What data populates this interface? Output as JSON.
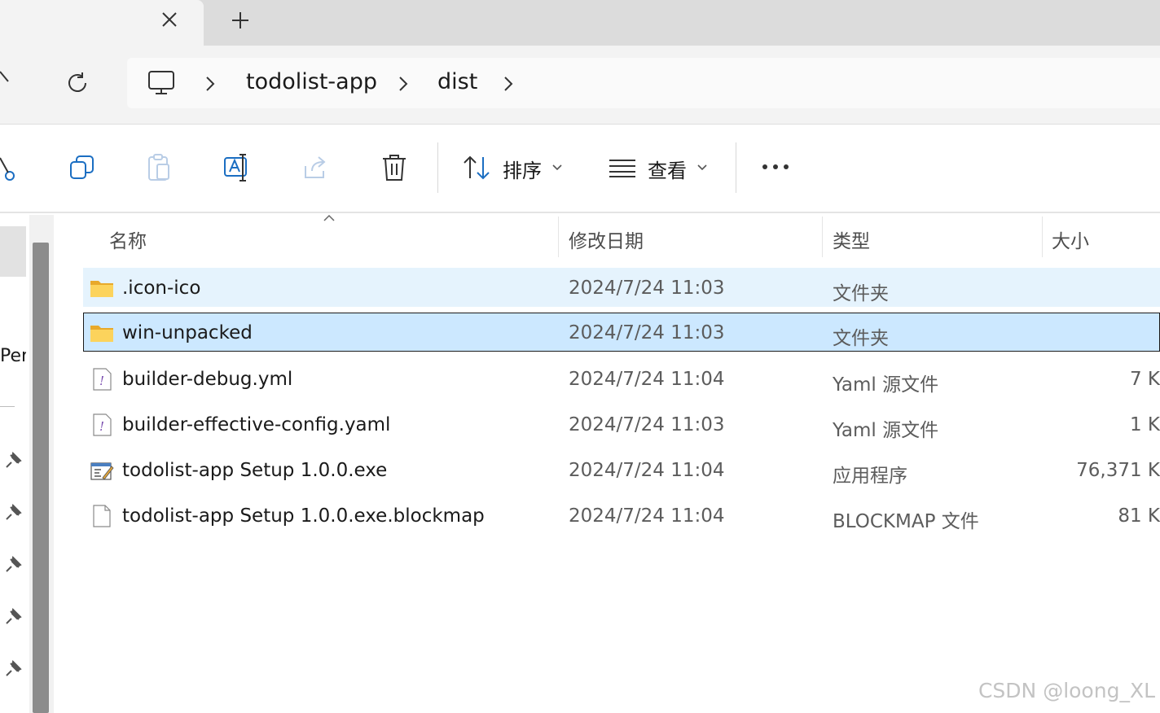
{
  "breadcrumb": {
    "items": [
      "todolist-app",
      "dist"
    ]
  },
  "toolbar": {
    "sort_label": "排序",
    "view_label": "查看"
  },
  "sidebar": {
    "partial_text": "Pers"
  },
  "file_list": {
    "columns": {
      "name": "名称",
      "date": "修改日期",
      "type": "类型",
      "size": "大小"
    },
    "rows": [
      {
        "name": ".icon-ico",
        "date": "2024/7/24 11:03",
        "type": "文件夹",
        "size": "",
        "icon": "folder-icon"
      },
      {
        "name": "win-unpacked",
        "date": "2024/7/24 11:03",
        "type": "文件夹",
        "size": "",
        "icon": "folder-icon"
      },
      {
        "name": "builder-debug.yml",
        "date": "2024/7/24 11:04",
        "type": "Yaml 源文件",
        "size": "7 K",
        "icon": "yaml-file-icon"
      },
      {
        "name": "builder-effective-config.yaml",
        "date": "2024/7/24 11:03",
        "type": "Yaml 源文件",
        "size": "1 K",
        "icon": "yaml-file-icon"
      },
      {
        "name": "todolist-app Setup 1.0.0.exe",
        "date": "2024/7/24 11:04",
        "type": "应用程序",
        "size": "76,371 K",
        "icon": "exe-file-icon"
      },
      {
        "name": "todolist-app Setup 1.0.0.exe.blockmap",
        "date": "2024/7/24 11:04",
        "type": "BLOCKMAP 文件",
        "size": "81 K",
        "icon": "blank-file-icon"
      }
    ]
  },
  "watermark": "CSDN @loong_XL",
  "colors": {
    "hover_row": "#e5f3fd",
    "selected_row": "#cce8ff",
    "folder": "#f8c537"
  }
}
